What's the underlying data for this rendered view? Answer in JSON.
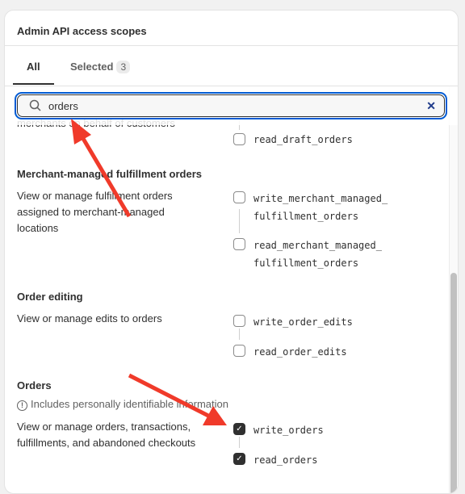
{
  "card": {
    "title": "Admin API access scopes"
  },
  "tabs": [
    {
      "label": "All"
    },
    {
      "label": "Selected",
      "count": "3"
    }
  ],
  "search": {
    "value": "orders",
    "icon": "search-icon",
    "clear_icon": "close-icon"
  },
  "sections": [
    {
      "description": "merchants on behalf of customers",
      "scopes": [
        {
          "name": "read_draft_orders",
          "checked": false
        }
      ]
    },
    {
      "title": "Merchant-managed fulfillment orders",
      "description": "View or manage fulfillment orders assigned to merchant-managed locations",
      "scopes": [
        {
          "name": "write_merchant_managed_ fulfillment_orders",
          "checked": false
        },
        {
          "name": "read_merchant_managed_ fulfillment_orders",
          "checked": false
        }
      ]
    },
    {
      "title": "Order editing",
      "description": "View or manage edits to orders",
      "scopes": [
        {
          "name": "write_order_edits",
          "checked": false
        },
        {
          "name": "read_order_edits",
          "checked": false
        }
      ]
    },
    {
      "title": "Orders",
      "warning": "Includes personally identifiable information",
      "description": "View or manage orders, transactions, fulfillments, and abandoned checkouts",
      "scopes": [
        {
          "name": "write_orders",
          "checked": true
        },
        {
          "name": "read_orders",
          "checked": true
        }
      ]
    }
  ],
  "colors": {
    "focus": "#005bd3",
    "annotation": "#f03a2a",
    "checked": "#303030"
  }
}
